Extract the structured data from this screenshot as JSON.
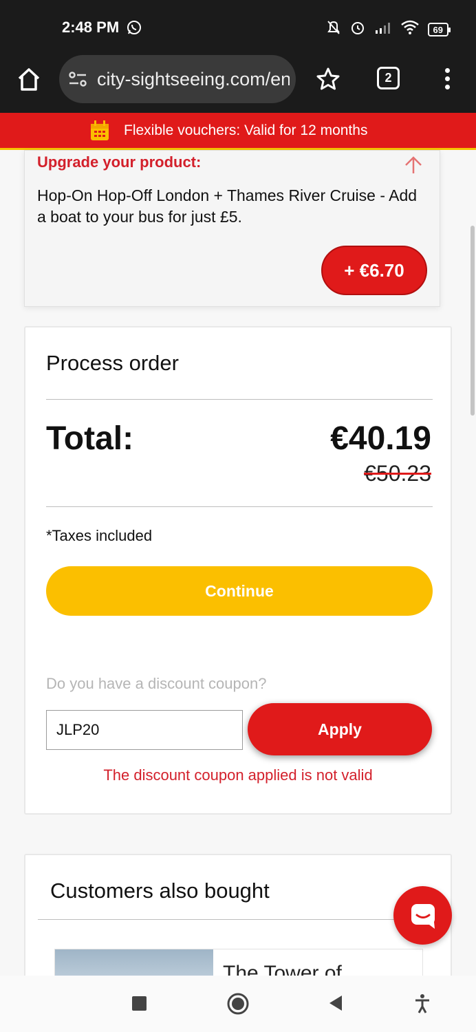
{
  "status_bar": {
    "time": "2:48 PM",
    "battery": "69"
  },
  "browser": {
    "url": "city-sightseeing.com/en/",
    "tab_count": "2"
  },
  "promo_banner": {
    "text": "Flexible vouchers: Valid for 12 months"
  },
  "upgrade": {
    "title": "Upgrade your product:",
    "description": "Hop-On Hop-Off London + Thames River Cruise - Add a boat to your bus for just £5.",
    "price_button": "+ €6.70"
  },
  "order": {
    "title": "Process order",
    "total_label": "Total:",
    "total_price": "€40.19",
    "old_price": "€50.23",
    "taxes_note": "*Taxes included",
    "continue_label": "Continue",
    "coupon_question": "Do you have a discount coupon?",
    "coupon_value": "JLP20",
    "apply_label": "Apply",
    "coupon_error": "The discount coupon applied is not valid"
  },
  "also_bought": {
    "title": "Customers also bought",
    "first_product": "The Tower of"
  },
  "colors": {
    "brand_red": "#e01a1a",
    "accent_yellow": "#fbbf00",
    "error_red": "#d3202b"
  }
}
